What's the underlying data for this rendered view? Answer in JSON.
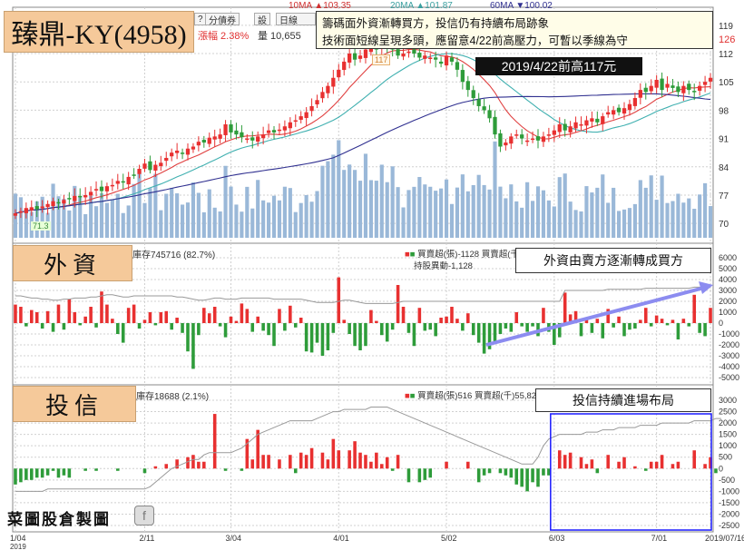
{
  "ma_legend": {
    "ma10": "10MA ▲103.35",
    "ma20": "20MA ▲101.87",
    "ma60": "60MA ▼100.02"
  },
  "toolbar": {
    "help": "?",
    "fenchaozhai": "分債券",
    "zhuan": "設",
    "period": "日線",
    "change": "漲幅 2.38%",
    "volume": "量 10,655",
    "price_right": "126"
  },
  "title": "臻鼎-KY(4958)",
  "note": {
    "line1": "籌碼面外資漸轉買方，投信仍有持續布局跡象",
    "line2": "技術面短線呈現多頭，應留意4/22前高壓力，可暫以季線為守"
  },
  "high_label": "2019/4/22前高117元",
  "high_tag": "117",
  "low_tag": "71.3",
  "foreign": {
    "label": "外資",
    "holding": "庫存745716 (82.7%)",
    "legend1": "買賣超(張)-1128 買賣超(千)",
    "legend2": "持股異動-1,128",
    "annotation": "外資由賣方逐漸轉成買方"
  },
  "trust": {
    "label": "投信",
    "holding": "庫存18688 (2.1%)",
    "legend1": "買賣超(張)516 買賣超(千)55,821",
    "annotation": "投信持續進場布局"
  },
  "brand": "菜圖股倉製圖",
  "colors": {
    "up": "#e83030",
    "down": "#2e9c3a",
    "ma10": "#e04040",
    "ma20": "#40b0b0",
    "ma60": "#303090",
    "volume": "#9ab8d8",
    "grid": "#d0d0d0",
    "arrow": "#8c8cf0",
    "highlight": "#1a1aff"
  },
  "chart_data": [
    {
      "type": "candlestick",
      "ylim": [
        66,
        123
      ],
      "yticks": [
        70,
        77,
        84,
        91,
        98,
        105,
        112,
        119
      ],
      "xticks": [
        {
          "i": 0,
          "label": "1/04",
          "sub": "2019"
        },
        {
          "i": 24,
          "label": "2/11"
        },
        {
          "i": 40,
          "label": "3/04"
        },
        {
          "i": 60,
          "label": "4/01"
        },
        {
          "i": 80,
          "label": "5/02"
        },
        {
          "i": 100,
          "label": "6/03"
        },
        {
          "i": 119,
          "label": "7/01"
        },
        {
          "i": 129,
          "label": "2019/07/16"
        }
      ],
      "close": [
        72.5,
        73.0,
        73.8,
        74.0,
        73.5,
        74.2,
        74.8,
        75.5,
        75.0,
        75.8,
        76.0,
        76.8,
        76.5,
        77.0,
        77.8,
        78.5,
        78.0,
        79.2,
        79.5,
        80.5,
        80.2,
        81.5,
        82.0,
        83.5,
        84.8,
        83.2,
        84.5,
        85.0,
        86.2,
        87.5,
        88.0,
        87.3,
        88.5,
        89.0,
        90.2,
        90.0,
        91.2,
        91.5,
        92.0,
        94.5,
        92.5,
        92.0,
        91.3,
        91.0,
        90.5,
        91.5,
        92.0,
        93.0,
        92.5,
        93.2,
        94.0,
        95.0,
        95.5,
        96.5,
        97.5,
        99.0,
        100.5,
        102.5,
        104.0,
        106.0,
        108.0,
        110.0,
        112.0,
        110.5,
        111.5,
        113.0,
        114.0,
        113.0,
        115.5,
        114.0,
        113.0,
        111.5,
        112.0,
        112.5,
        112.0,
        111.0,
        111.5,
        111.0,
        110.5,
        109.5,
        111.5,
        110.0,
        108.0,
        105.0,
        103.0,
        101.0,
        99.0,
        98.0,
        96.0,
        92.0,
        89.0,
        90.0,
        91.5,
        92.0,
        91.0,
        90.5,
        91.0,
        90.5,
        91.5,
        92.0,
        93.0,
        94.5,
        93.0,
        94.0,
        95.0,
        94.5,
        95.5,
        96.0,
        95.0,
        96.5,
        97.5,
        98.0,
        97.5,
        98.5,
        99.5,
        101.0,
        103.0,
        102.5,
        104.0,
        105.5,
        103.0,
        104.5,
        103.5,
        102.5,
        104.0,
        103.0,
        102.5,
        104.0,
        105.0,
        106.0
      ],
      "ma10_last": 103.35,
      "ma20_last": 101.87,
      "ma60_last": 100.02,
      "volume_max_k": 28,
      "volume_note": "relative daily volume in thousands (approx.)"
    },
    {
      "type": "bar",
      "name": "foreign",
      "ylim": [
        -5500,
        6500
      ],
      "yticks": [
        6000,
        5000,
        4000,
        3000,
        2000,
        1000,
        0,
        -1000,
        -2000,
        -3000,
        -4000,
        -5000
      ],
      "values": [
        1700,
        1500,
        -300,
        1200,
        1000,
        -500,
        1100,
        -800,
        1700,
        -600,
        2200,
        1000,
        -200,
        600,
        1500,
        -400,
        2900,
        1700,
        400,
        -1000,
        -1800,
        1400,
        1700,
        -500,
        300,
        1000,
        -200,
        1000,
        1100,
        -600,
        500,
        -900,
        -2600,
        -4200,
        -1100,
        1400,
        900,
        1500,
        -300,
        -1300,
        600,
        200,
        1800,
        1300,
        -800,
        600,
        -700,
        -1100,
        -2100,
        1300,
        -700,
        1600,
        -400,
        500,
        -2600,
        -2700,
        -1800,
        -3000,
        -2500,
        -900,
        4200,
        300,
        -1000,
        -2100,
        -2500,
        -2100,
        1200,
        200,
        -1100,
        -1700,
        -600,
        3500,
        1500,
        -900,
        -2100,
        1400,
        -700,
        -600,
        -1200,
        500,
        600,
        1500,
        400,
        -700,
        900,
        -1100,
        -1800,
        -2800,
        -2400,
        -1700,
        -1000,
        -500,
        -800,
        1000,
        -300,
        -800,
        -300,
        -1200,
        1400,
        -800,
        -2000,
        -1300,
        2800,
        800,
        1100,
        -1200,
        300,
        -900,
        400,
        -1400,
        1300,
        -400,
        600,
        -1200,
        -600,
        -500,
        300,
        1400,
        -300,
        700,
        400,
        -200,
        300,
        -1500,
        400,
        -300,
        2600,
        -900,
        -1200,
        1400
      ],
      "holding_line": [
        2500,
        2500,
        2400,
        2300,
        2300,
        2200,
        2200,
        2100,
        2100,
        2200,
        2200,
        2300,
        2300,
        2300,
        2400,
        2400,
        2500,
        2600,
        2600,
        2500,
        2400,
        2400,
        2500,
        2500,
        2500,
        2500,
        2500,
        2500,
        2500,
        2500,
        2400,
        2400,
        2300,
        2200,
        2100,
        2100,
        2200,
        2300,
        2300,
        2200,
        2200,
        2200,
        2300,
        2300,
        2300,
        2300,
        2300,
        2300,
        2200,
        2200,
        2200,
        2200,
        2200,
        2200,
        2100,
        2000,
        1900,
        1900,
        1900,
        1900,
        2000,
        2100,
        2100,
        2000,
        1900,
        1800,
        1800,
        1800,
        1800,
        1800,
        1800,
        1900,
        2000,
        2000,
        2000,
        2000,
        2000,
        2000,
        2000,
        2000,
        2000,
        2000,
        2000,
        2000,
        2000,
        2000,
        2000,
        2000,
        2000,
        2000,
        2000,
        2000,
        2000,
        2000,
        2000,
        2000,
        2000,
        2000,
        2000,
        2000,
        2000,
        2000,
        3000,
        3000,
        3000,
        3000,
        3000,
        3000,
        3000,
        3000,
        3100,
        3100,
        3100,
        3100,
        3100,
        3100,
        3100,
        3200,
        3200,
        3200,
        3200,
        3200,
        3200,
        3200,
        3200,
        3200,
        3300,
        3300,
        3300,
        3300
      ]
    },
    {
      "type": "bar",
      "name": "trust",
      "ylim": [
        -2700,
        3200
      ],
      "yticks": [
        3000,
        2500,
        2000,
        1500,
        1000,
        500,
        0,
        -500,
        -1000,
        -1500,
        -2000,
        -2500
      ],
      "values": [
        -700,
        -600,
        -500,
        -500,
        -400,
        -400,
        -300,
        -100,
        -400,
        -300,
        -400,
        0,
        0,
        -100,
        0,
        -100,
        0,
        0,
        0,
        -100,
        0,
        0,
        0,
        0,
        -200,
        0,
        100,
        0,
        200,
        0,
        400,
        0,
        500,
        600,
        300,
        300,
        0,
        2400,
        0,
        -100,
        0,
        0,
        -100,
        1300,
        400,
        1700,
        600,
        600,
        0,
        400,
        0,
        600,
        -200,
        700,
        600,
        900,
        0,
        700,
        400,
        1300,
        800,
        0,
        800,
        1200,
        700,
        600,
        300,
        700,
        200,
        500,
        -100,
        600,
        0,
        -600,
        0,
        -600,
        -500,
        -400,
        0,
        0,
        300,
        0,
        0,
        0,
        300,
        0,
        -600,
        -300,
        -200,
        0,
        -200,
        -300,
        -400,
        -700,
        -800,
        -1000,
        -600,
        -800,
        -300,
        -300,
        0,
        800,
        600,
        700,
        0,
        500,
        200,
        400,
        -200,
        0,
        600,
        0,
        300,
        500,
        0,
        100,
        0,
        -100,
        300,
        300,
        600,
        0,
        200,
        300,
        0,
        0,
        800,
        0,
        200,
        500,
        -200
      ],
      "holding_line": [
        -1000,
        -1000,
        -1000,
        -1000,
        -1000,
        -1000,
        -900,
        -900,
        -900,
        -900,
        -900,
        -900,
        -900,
        -900,
        -900,
        -900,
        -900,
        -900,
        -900,
        -900,
        -900,
        -900,
        -900,
        -900,
        -900,
        -800,
        -600,
        -400,
        -200,
        0,
        100,
        200,
        300,
        400,
        400,
        600,
        700,
        700,
        700,
        700,
        700,
        800,
        900,
        1100,
        1300,
        1500,
        1600,
        1700,
        1800,
        1900,
        2000,
        2100,
        2100,
        2100,
        2100,
        2100,
        2200,
        2300,
        2400,
        2500,
        2500,
        2600,
        2600,
        2600,
        2600,
        2600,
        2700,
        2700,
        2700,
        2700,
        2600,
        2500,
        2400,
        2300,
        2200,
        2100,
        2000,
        1900,
        1800,
        1700,
        1600,
        1500,
        1400,
        1300,
        1200,
        1100,
        1000,
        900,
        800,
        700,
        600,
        500,
        400,
        300,
        200,
        200,
        200,
        500,
        1000,
        1300,
        1400,
        1500,
        1500,
        1500,
        1500,
        1500,
        1600,
        1600,
        1600,
        1700,
        1700,
        1700,
        1800,
        1800,
        1800,
        1800,
        1900,
        1900,
        1900,
        1900,
        2000,
        2000,
        2000,
        2000,
        2000,
        2000,
        2100,
        2100,
        2100,
        2100,
        2200,
        2200
      ]
    }
  ]
}
